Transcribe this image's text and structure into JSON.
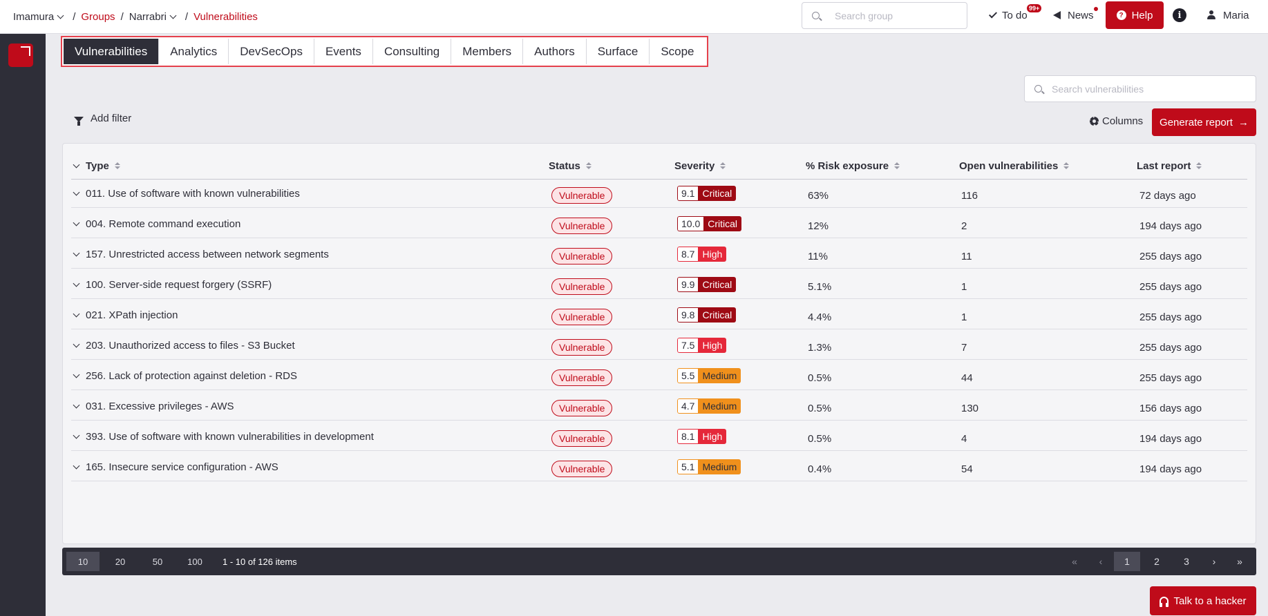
{
  "breadcrumb": {
    "org": "Imamura",
    "groups": "Groups",
    "group": "Narrabri",
    "current": "Vulnerabilities",
    "separator": "/"
  },
  "topbar": {
    "search_placeholder": "Search group",
    "todo_label": "To do",
    "todo_badge": "99+",
    "news_label": "News",
    "help_label": "Help",
    "info_label": "i",
    "user_name": "Maria"
  },
  "tabs": [
    {
      "label": "Vulnerabilities",
      "active": true
    },
    {
      "label": "Analytics"
    },
    {
      "label": "DevSecOps"
    },
    {
      "label": "Events"
    },
    {
      "label": "Consulting"
    },
    {
      "label": "Members"
    },
    {
      "label": "Authors"
    },
    {
      "label": "Surface"
    },
    {
      "label": "Scope"
    }
  ],
  "toolbar": {
    "search_placeholder": "Search vulnerabilities",
    "add_filter_label": "Add filter",
    "columns_label": "Columns",
    "generate_report_label": "Generate report"
  },
  "table": {
    "headers": {
      "type": "Type",
      "status": "Status",
      "severity": "Severity",
      "risk": "% Risk exposure",
      "open": "Open vulnerabilities",
      "last": "Last report"
    },
    "rows": [
      {
        "type": "011. Use of software with known vulnerabilities",
        "status": "Vulnerable",
        "score": "9.1",
        "severity": "Critical",
        "level": "critical",
        "risk": "63%",
        "open": "116",
        "last": "72 days ago"
      },
      {
        "type": "004. Remote command execution",
        "status": "Vulnerable",
        "score": "10.0",
        "severity": "Critical",
        "level": "critical",
        "risk": "12%",
        "open": "2",
        "last": "194 days ago"
      },
      {
        "type": "157. Unrestricted access between network segments",
        "status": "Vulnerable",
        "score": "8.7",
        "severity": "High",
        "level": "high",
        "risk": "11%",
        "open": "11",
        "last": "255 days ago"
      },
      {
        "type": "100. Server-side request forgery (SSRF)",
        "status": "Vulnerable",
        "score": "9.9",
        "severity": "Critical",
        "level": "critical",
        "risk": "5.1%",
        "open": "1",
        "last": "255 days ago"
      },
      {
        "type": "021. XPath injection",
        "status": "Vulnerable",
        "score": "9.8",
        "severity": "Critical",
        "level": "critical",
        "risk": "4.4%",
        "open": "1",
        "last": "255 days ago"
      },
      {
        "type": "203. Unauthorized access to files - S3 Bucket",
        "status": "Vulnerable",
        "score": "7.5",
        "severity": "High",
        "level": "high",
        "risk": "1.3%",
        "open": "7",
        "last": "255 days ago"
      },
      {
        "type": "256. Lack of protection against deletion - RDS",
        "status": "Vulnerable",
        "score": "5.5",
        "severity": "Medium",
        "level": "medium",
        "risk": "0.5%",
        "open": "44",
        "last": "255 days ago"
      },
      {
        "type": "031. Excessive privileges - AWS",
        "status": "Vulnerable",
        "score": "4.7",
        "severity": "Medium",
        "level": "medium",
        "risk": "0.5%",
        "open": "130",
        "last": "156 days ago"
      },
      {
        "type": "393. Use of software with known vulnerabilities in development",
        "status": "Vulnerable",
        "score": "8.1",
        "severity": "High",
        "level": "high",
        "risk": "0.5%",
        "open": "4",
        "last": "194 days ago"
      },
      {
        "type": "165. Insecure service configuration - AWS",
        "status": "Vulnerable",
        "score": "5.1",
        "severity": "Medium",
        "level": "medium",
        "risk": "0.4%",
        "open": "54",
        "last": "194 days ago"
      }
    ]
  },
  "pagination": {
    "sizes": [
      "10",
      "20",
      "50",
      "100"
    ],
    "active_size": "10",
    "summary": "1 - 10 of 126 items",
    "first": "«",
    "prev": "‹",
    "pages": [
      "1",
      "2",
      "3"
    ],
    "active_page": "1",
    "next": "›",
    "last": "»"
  },
  "talk_label": "Talk to a hacker",
  "colors": {
    "brand": "#bf0b1a",
    "dark": "#2e2e38",
    "critical": "#9e0a14",
    "high": "#e5283a",
    "medium": "#f0901c"
  }
}
